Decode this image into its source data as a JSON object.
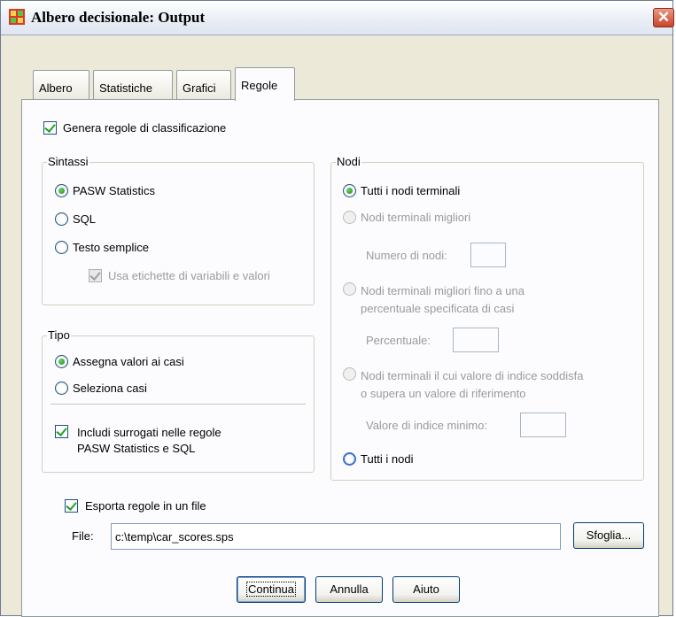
{
  "window": {
    "title": "Albero decisionale: Output",
    "close_glyph": "✕"
  },
  "tabs": [
    {
      "label": "Albero",
      "active": false
    },
    {
      "label": "Statistiche",
      "active": false
    },
    {
      "label": "Grafici",
      "active": false
    },
    {
      "label": "Regole",
      "active": true
    }
  ],
  "generate_rules": {
    "label": "Genera regole di classificazione",
    "checked": true
  },
  "syntax": {
    "legend": "Sintassi",
    "options": [
      {
        "label": "PASW Statistics",
        "selected": true
      },
      {
        "label": "SQL",
        "selected": false
      },
      {
        "label": "Testo semplice",
        "selected": false
      }
    ],
    "use_labels": {
      "label": "Usa etichette di variabili e valori",
      "checked": true,
      "enabled": false
    }
  },
  "type": {
    "legend": "Tipo",
    "options": [
      {
        "label": "Assegna valori ai casi",
        "selected": true
      },
      {
        "label": "Seleziona casi",
        "selected": false
      }
    ],
    "surrogates": {
      "label_line1": "Includi surrogati nelle regole",
      "label_line2": "PASW Statistics e SQL",
      "checked": true
    }
  },
  "nodes": {
    "legend": "Nodi",
    "all_terminal": "Tutti i nodi terminali",
    "best_terminal": "Nodi terminali migliori",
    "num_nodes_label": "Numero di nodi:",
    "best_percent_line1": "Nodi terminali migliori fino a una",
    "best_percent_line2": "percentuale specificata di casi",
    "percent_label": "Percentuale:",
    "index_line1": "Nodi terminali il cui valore di indice soddisfa",
    "index_line2": "o supera un valore di riferimento",
    "min_index_label": "Valore di indice minimo:",
    "all_nodes": "Tutti i nodi"
  },
  "export": {
    "label": "Esporta regole in un file",
    "checked": true,
    "file_label": "File:",
    "file_value": "c:\\temp\\car_scores.sps",
    "browse_label": "Sfoglia..."
  },
  "buttons": {
    "continue": "Continua",
    "cancel": "Annulla",
    "help": "Aiuto"
  },
  "colors": {
    "dialog_bg": "#ece9d8",
    "panel_bg": "#fcfcfe",
    "check_green": "#21a121",
    "close_red": "#c8442a"
  }
}
